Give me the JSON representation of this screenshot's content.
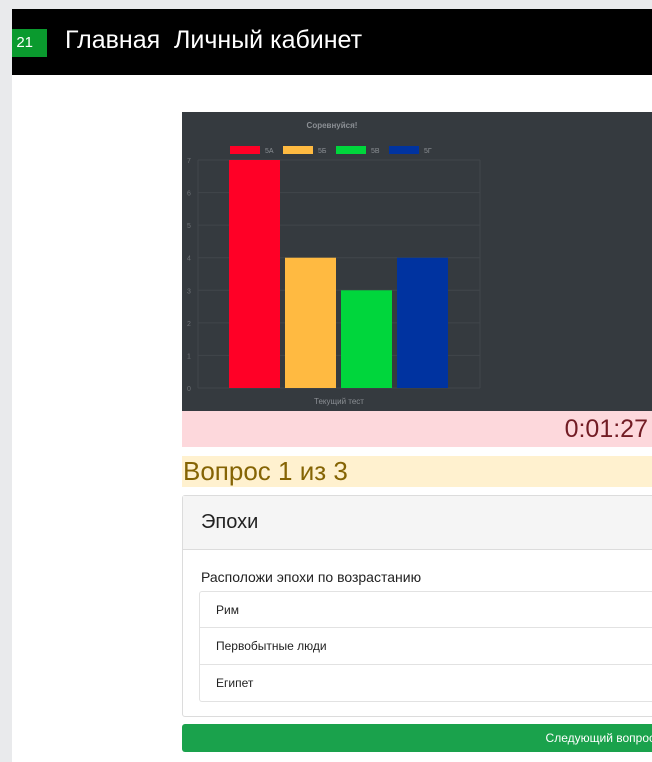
{
  "nav": {
    "badge": "21",
    "home": "Главная",
    "cabinet": "Личный кабинет"
  },
  "chart_data": {
    "type": "bar",
    "title": "Соревнуйся!",
    "xlabel": "Текущий тест",
    "ylabel": "",
    "ylim": [
      0,
      7
    ],
    "yticks": [
      "0",
      "1",
      "2",
      "3",
      "4",
      "5",
      "6",
      "7"
    ],
    "legend_position": "top",
    "grid": true,
    "series": [
      {
        "name": "5А",
        "values": [
          7
        ],
        "color": "#ff0026"
      },
      {
        "name": "5Б",
        "values": [
          4
        ],
        "color": "#ffba41"
      },
      {
        "name": "5В",
        "values": [
          3
        ],
        "color": "#00d63c"
      },
      {
        "name": "5Г",
        "values": [
          4
        ],
        "color": "#0033a0"
      }
    ]
  },
  "timer": {
    "value": "0:01:27"
  },
  "question": {
    "progress": "Вопрос 1 из 3",
    "title": "Эпохи",
    "prompt": "Расположи эпохи по возрастанию",
    "answers": [
      "Рим",
      "Первобытные люди",
      "Египет"
    ]
  },
  "actions": {
    "next": "Следующий вопрос"
  }
}
